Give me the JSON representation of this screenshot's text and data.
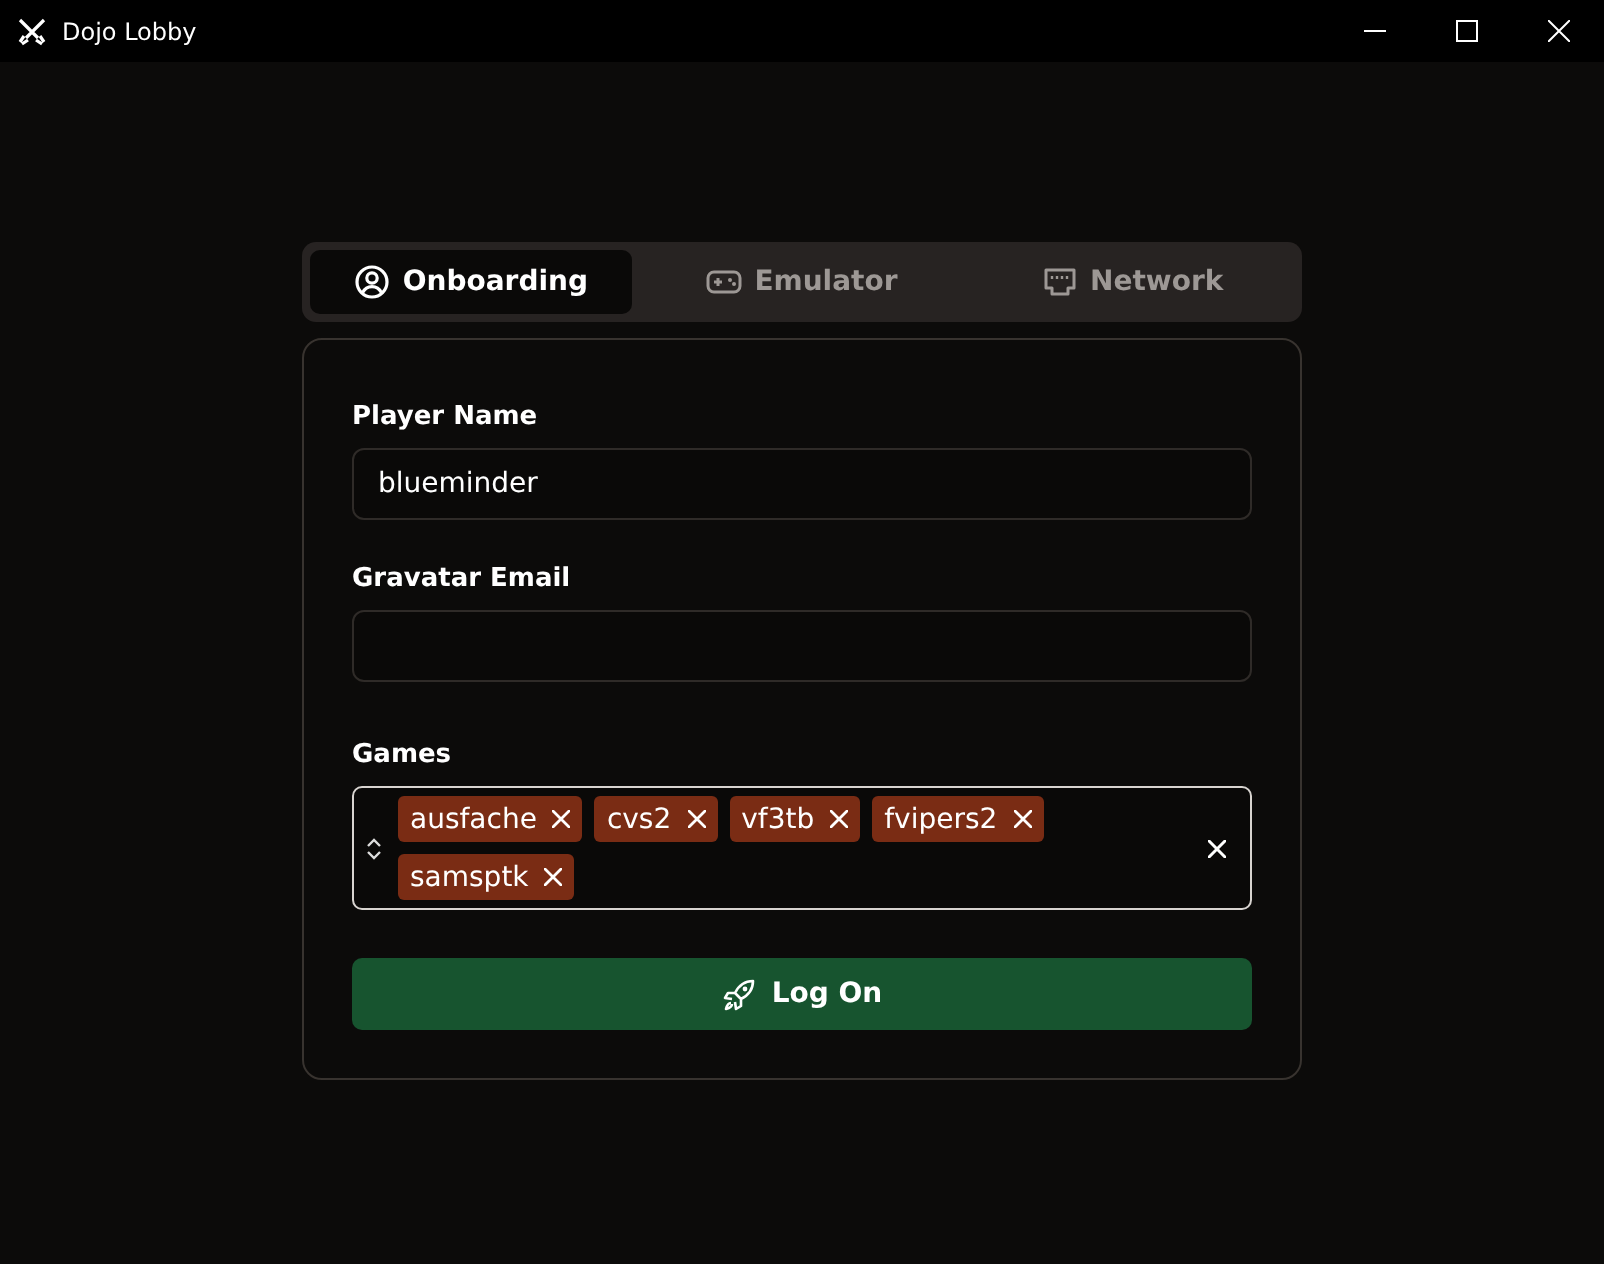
{
  "window": {
    "title": "Dojo Lobby"
  },
  "tabs": [
    {
      "label": "Onboarding",
      "kind": "person",
      "selected": true
    },
    {
      "label": "Emulator",
      "kind": "gamepad",
      "selected": false
    },
    {
      "label": "Network",
      "kind": "ethernet",
      "selected": false
    }
  ],
  "form": {
    "fields": [
      {
        "label": "Player Name",
        "value": "blueminder"
      },
      {
        "label": "Gravatar Email"
      }
    ],
    "games": {
      "label": "Games",
      "tags": [
        "ausfache",
        "cvs2",
        "vf3tb",
        "fvipers2",
        "samsptk"
      ]
    },
    "submit": {
      "label": "Log On"
    }
  }
}
